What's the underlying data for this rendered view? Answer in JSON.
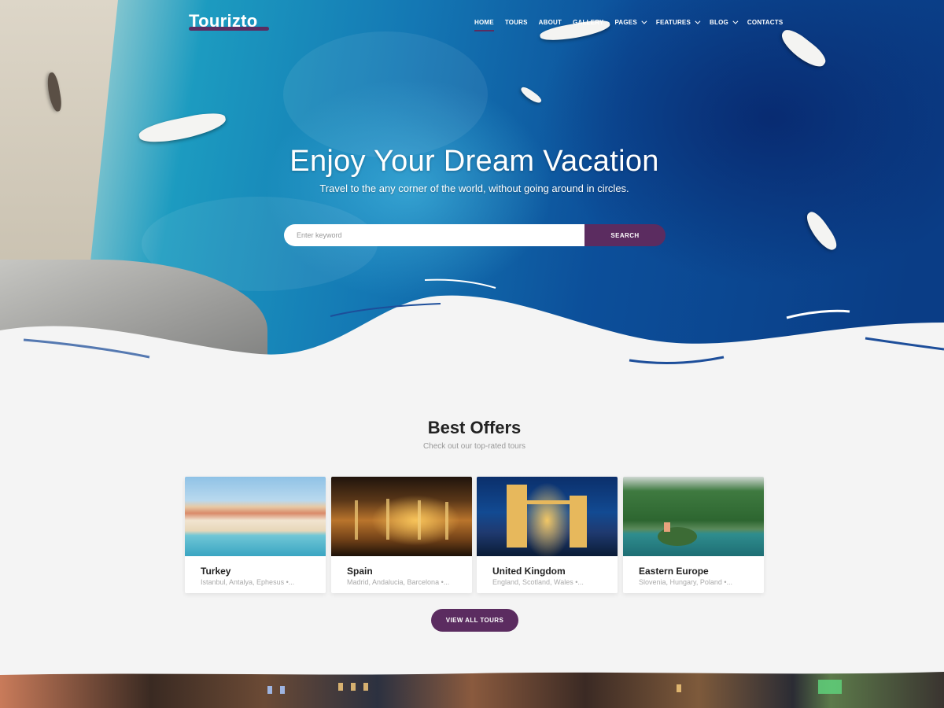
{
  "brand": {
    "logo": "Tourizto",
    "accent": "#5b2c60"
  },
  "nav": {
    "items": [
      {
        "label": "HOME",
        "active": true,
        "dropdown": false
      },
      {
        "label": "TOURS",
        "active": false,
        "dropdown": false
      },
      {
        "label": "ABOUT",
        "active": false,
        "dropdown": false
      },
      {
        "label": "GALLERY",
        "active": false,
        "dropdown": false
      },
      {
        "label": "PAGES",
        "active": false,
        "dropdown": true
      },
      {
        "label": "FEATURES",
        "active": false,
        "dropdown": true
      },
      {
        "label": "BLOG",
        "active": false,
        "dropdown": true
      },
      {
        "label": "CONTACTS",
        "active": false,
        "dropdown": false
      }
    ]
  },
  "hero": {
    "title": "Enjoy Your Dream Vacation",
    "subtitle": "Travel to the any corner of the world, without going around in circles.",
    "search": {
      "placeholder": "Enter keyword",
      "button_label": "SEARCH"
    }
  },
  "offers": {
    "title": "Best Offers",
    "subtitle": "Check out our top-rated tours",
    "cards": [
      {
        "title": "Turkey",
        "desc": "Istanbul, Antalya, Ephesus •..."
      },
      {
        "title": "Spain",
        "desc": "Madrid, Andalucia, Barcelona •..."
      },
      {
        "title": "United Kingdom",
        "desc": "England, Scotland, Wales •..."
      },
      {
        "title": "Eastern Europe",
        "desc": "Slovenia, Hungary, Poland •..."
      }
    ],
    "view_all_label": "VIEW ALL TOURS"
  }
}
